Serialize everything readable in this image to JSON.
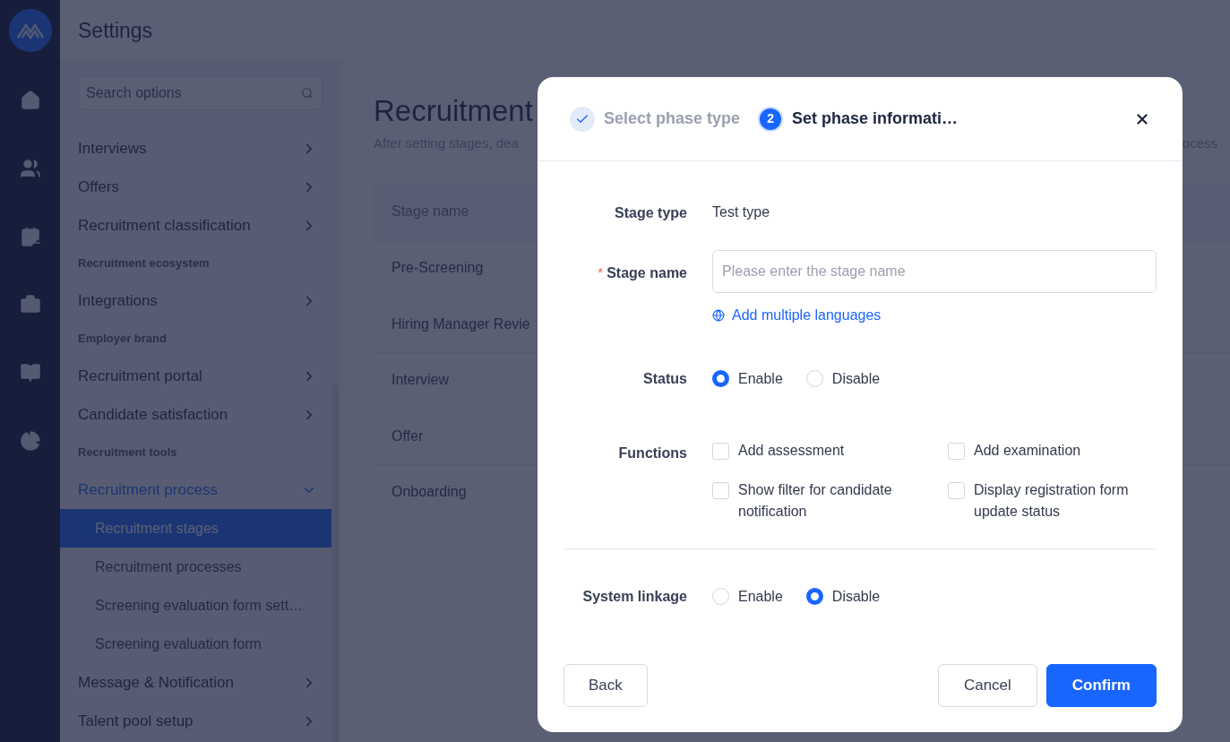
{
  "header": {
    "title": "Settings"
  },
  "settings_nav": {
    "search": {
      "placeholder": "Search options"
    },
    "items": [
      {
        "kind": "item",
        "label": "Interviews",
        "expanded": false
      },
      {
        "kind": "item",
        "label": "Offers",
        "expanded": false
      },
      {
        "kind": "item",
        "label": "Recruitment classification",
        "expanded": false
      },
      {
        "kind": "section",
        "label": "Recruitment ecosystem"
      },
      {
        "kind": "item",
        "label": "Integrations",
        "expanded": false
      },
      {
        "kind": "section",
        "label": "Employer brand"
      },
      {
        "kind": "item",
        "label": "Recruitment portal",
        "expanded": false
      },
      {
        "kind": "item",
        "label": "Candidate satisfaction",
        "expanded": false
      },
      {
        "kind": "section",
        "label": "Recruitment tools"
      },
      {
        "kind": "item",
        "label": "Recruitment process",
        "expanded": true,
        "children": [
          {
            "label": "Recruitment stages",
            "selected": true
          },
          {
            "label": "Recruitment processes",
            "selected": false
          },
          {
            "label": "Screening evaluation form sett…",
            "selected": false
          },
          {
            "label": "Screening evaluation form",
            "selected": false
          }
        ]
      },
      {
        "kind": "item",
        "label": "Message & Notification",
        "expanded": false
      },
      {
        "kind": "item",
        "label": "Talent pool setup",
        "expanded": false
      }
    ]
  },
  "page": {
    "title": "Recruitment",
    "subtitle_left": "After setting stages, dea",
    "subtitle_right": "ocess",
    "table": {
      "columns": [
        "Stage name"
      ],
      "rows": [
        "Pre-Screening",
        "Hiring Manager Revie",
        "Interview",
        "Offer",
        "Onboarding"
      ]
    }
  },
  "dialog": {
    "steps": [
      {
        "kind": "done",
        "label": "Select phase type"
      },
      {
        "kind": "current",
        "number": "2",
        "label": "Set phase informati…"
      }
    ],
    "fields": [
      {
        "kind": "text",
        "label": "Stage type",
        "value": "Test type"
      },
      {
        "kind": "input",
        "label": "Stage name",
        "required_mark": "*",
        "placeholder": "Please enter the stage name",
        "link": "Add multiple languages"
      },
      {
        "kind": "radio",
        "label": "Status",
        "options": [
          {
            "label": "Enable",
            "selected": true
          },
          {
            "label": "Disable",
            "selected": false
          }
        ]
      },
      {
        "kind": "checkboxes",
        "label": "Functions",
        "options": [
          {
            "label": "Add assessment",
            "checked": false
          },
          {
            "label": "Add examination",
            "checked": false
          },
          {
            "label": "Show filter for candidate notification",
            "checked": false
          },
          {
            "label": "Display registration form update status",
            "checked": false
          }
        ]
      },
      {
        "kind": "radio",
        "label": "System linkage",
        "divider_before": true,
        "options": [
          {
            "label": "Enable",
            "selected": false
          },
          {
            "label": "Disable",
            "selected": true
          }
        ]
      }
    ],
    "footer": {
      "left": [
        {
          "kind": "secondary",
          "label": "Back"
        }
      ],
      "right": [
        {
          "kind": "secondary",
          "label": "Cancel"
        },
        {
          "kind": "primary",
          "label": "Confirm"
        }
      ]
    }
  }
}
